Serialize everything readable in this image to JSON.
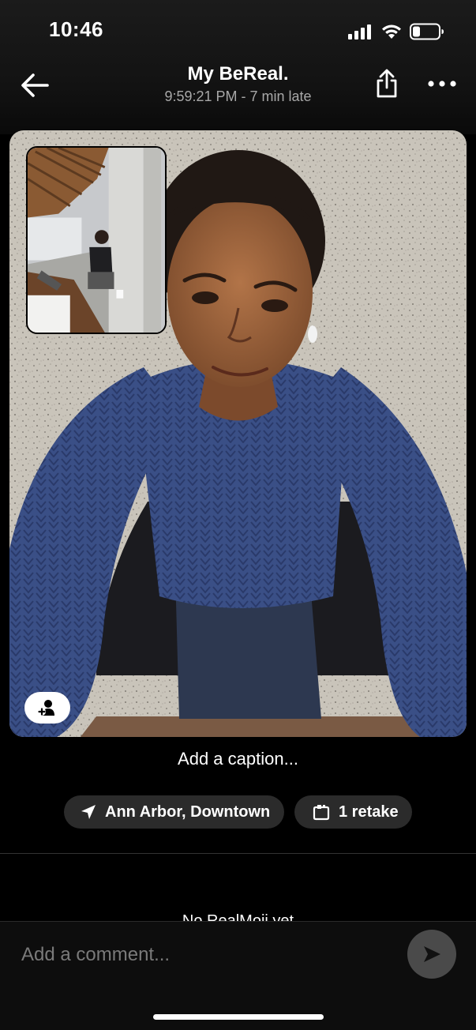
{
  "status_bar": {
    "time": "10:46"
  },
  "header": {
    "title": "My BeReal.",
    "subtitle": "9:59:21 PM - 7 min late"
  },
  "photo": {
    "caption": "Add a caption..."
  },
  "chips": {
    "location": "Ann Arbor, Downtown",
    "retake": "1 retake"
  },
  "realmoji": {
    "text": "No RealMoji yet"
  },
  "comment": {
    "placeholder": "Add a comment..."
  },
  "colors": {
    "background": "#000000",
    "chip_background": "#2b2b2b",
    "send_button": "#4a4a4a",
    "subtitle_gray": "#a8a8a8"
  },
  "icons": {
    "back": "arrow-left-icon",
    "share": "share-icon",
    "more": "more-horizontal-icon",
    "tag": "add-person-icon",
    "location": "location-arrow-icon",
    "retake": "retake-icon",
    "send": "send-icon"
  }
}
